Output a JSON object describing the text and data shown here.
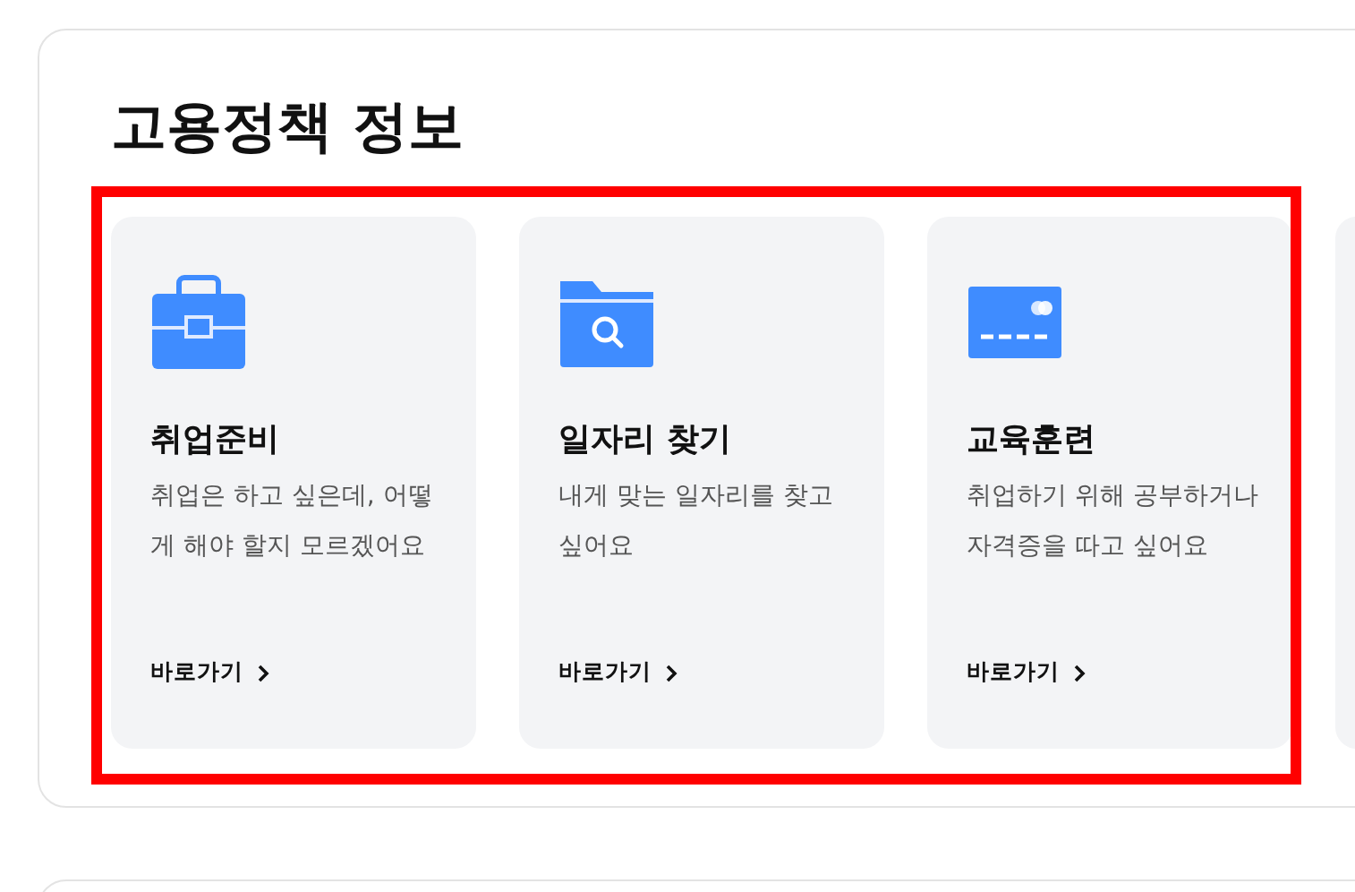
{
  "section": {
    "title": "고용정책 정보"
  },
  "cards": [
    {
      "kind": "briefcase",
      "title": "취업준비",
      "description": "취업은 하고 싶은데, 어떻게 해야 할지 모르겠어요",
      "link": "바로가기"
    },
    {
      "kind": "folder",
      "title": "일자리 찾기",
      "description": "내게 맞는 일자리를 찾고 싶어요",
      "link": "바로가기"
    },
    {
      "kind": "card",
      "title": "교육훈련",
      "description": "취업하기 위해 공부하거나 자격증을 따고 싶어요",
      "link": "바로가기"
    }
  ]
}
